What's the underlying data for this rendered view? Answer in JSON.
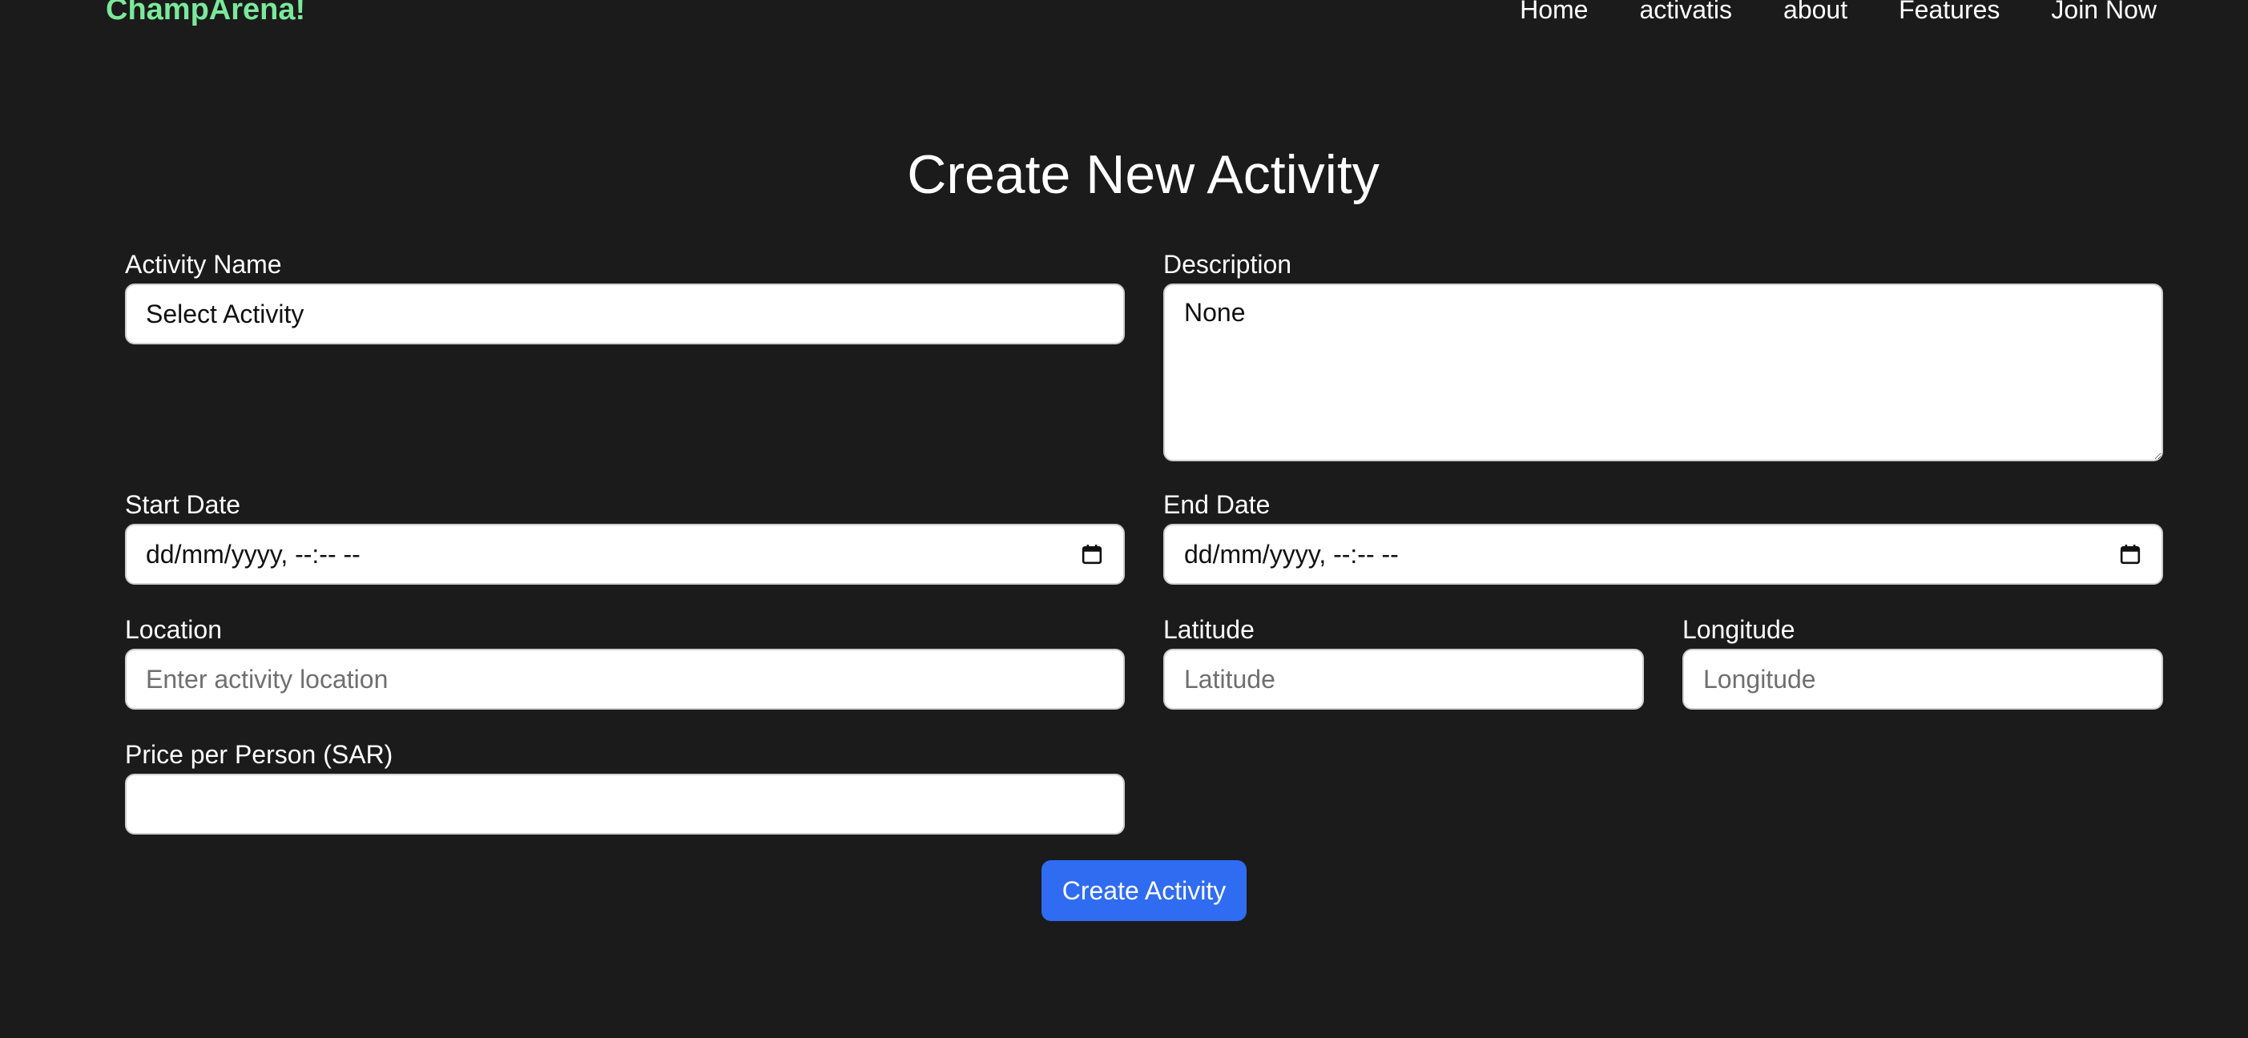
{
  "brand": "ChampArena!",
  "nav": {
    "items": [
      "Home",
      "activatis",
      "about",
      "Features",
      "Join Now"
    ]
  },
  "page_title": "Create New Activity",
  "form": {
    "activity_name": {
      "label": "Activity Name",
      "value": "Select Activity"
    },
    "description": {
      "label": "Description",
      "value": "None"
    },
    "start_date": {
      "label": "Start Date",
      "value": "dd/mm/yyyy, --:-- --"
    },
    "end_date": {
      "label": "End Date",
      "value": "dd/mm/yyyy, --:-- --"
    },
    "location": {
      "label": "Location",
      "placeholder": "Enter activity location"
    },
    "latitude": {
      "label": "Latitude",
      "placeholder": "Latitude"
    },
    "longitude": {
      "label": "Longitude",
      "placeholder": "Longitude"
    },
    "price": {
      "label": "Price per Person (SAR)",
      "value": ""
    },
    "submit_label": "Create Activity"
  },
  "icons": {
    "calendar": "calendar-icon"
  },
  "colors": {
    "background": "#1b1b1b",
    "brand": "#7be89b",
    "primary_button": "#2f6cf2"
  }
}
